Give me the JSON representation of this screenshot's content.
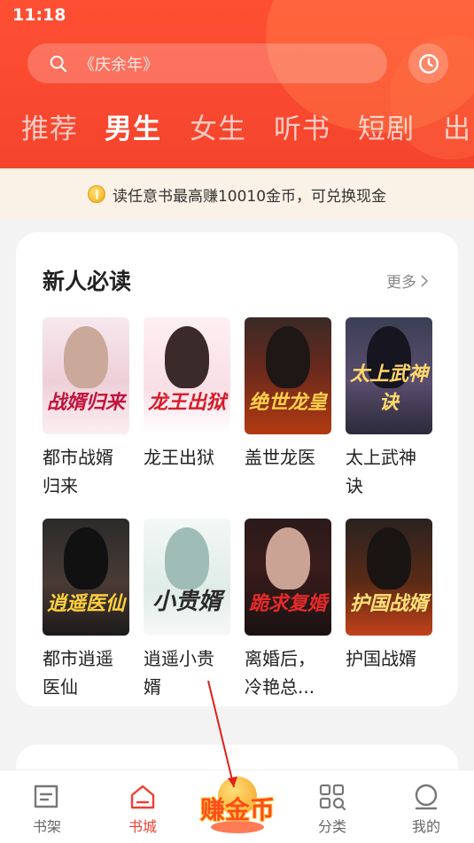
{
  "status": {
    "time": "11:18"
  },
  "search": {
    "placeholder": "《庆余年》"
  },
  "tabs": [
    "推荐",
    "男生",
    "女生",
    "听书",
    "短剧",
    "出"
  ],
  "promo": {
    "text": "读任意书最高赚10010金币，可兑换现金"
  },
  "section": {
    "title": "新人必读",
    "more_label": "更多",
    "books": [
      {
        "name": "都市战婿\n归来",
        "cover_title": "战婿归来"
      },
      {
        "name": "龙王出狱",
        "cover_title": "龙王出狱"
      },
      {
        "name": "盖世龙医",
        "cover_title": "绝世龙皇"
      },
      {
        "name": "太上武神\n诀",
        "cover_title": "太上武神诀"
      },
      {
        "name": "都市逍遥\n医仙",
        "cover_title": "逍遥医仙"
      },
      {
        "name": "逍遥小贵\n婿",
        "cover_title": "小贵婿"
      },
      {
        "name": "离婚后，\n冷艳总...",
        "cover_title": "跪求复婚"
      },
      {
        "name": "护国战婿",
        "cover_title": "护国战婿"
      }
    ]
  },
  "nav": {
    "bookshelf": "书架",
    "bookstore": "书城",
    "earn": "赚金币",
    "category": "分类",
    "mine": "我的"
  },
  "colors": {
    "accent": "#ef3f33",
    "header": "#f4442d"
  }
}
